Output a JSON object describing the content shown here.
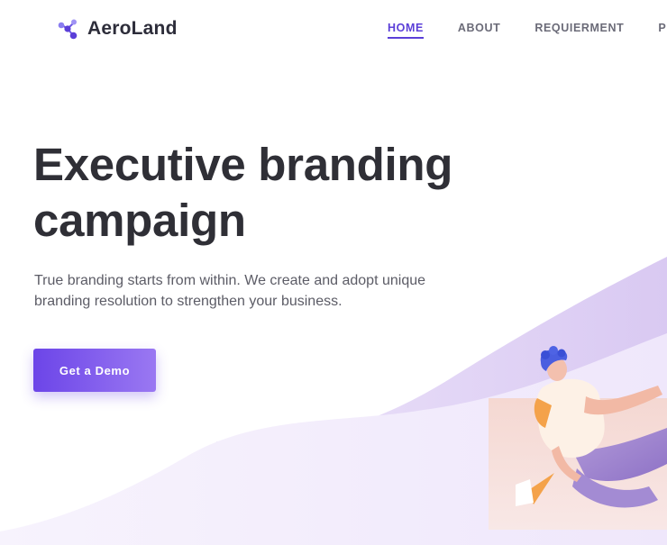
{
  "header": {
    "brand_name": "AeroLand",
    "nav": [
      {
        "label": "HOME",
        "active": true
      },
      {
        "label": "ABOUT",
        "active": false
      },
      {
        "label": "REQUIERMENT",
        "active": false
      },
      {
        "label": "PRI",
        "active": false
      }
    ]
  },
  "hero": {
    "title": "Executive branding campaign",
    "subtitle": "True branding starts from within. We create and adopt unique branding resolution to strengthen your business.",
    "cta_label": "Get a Demo"
  },
  "colors": {
    "accent": "#5b3fd8",
    "cta_start": "#6c45e8",
    "cta_end": "#9a78f2",
    "wave_light": "#f2ecfb",
    "wave_dark": "#ddcff3"
  },
  "icons": {
    "brand": "molecule-logo-icon",
    "illustration": "person-running-illustration"
  }
}
